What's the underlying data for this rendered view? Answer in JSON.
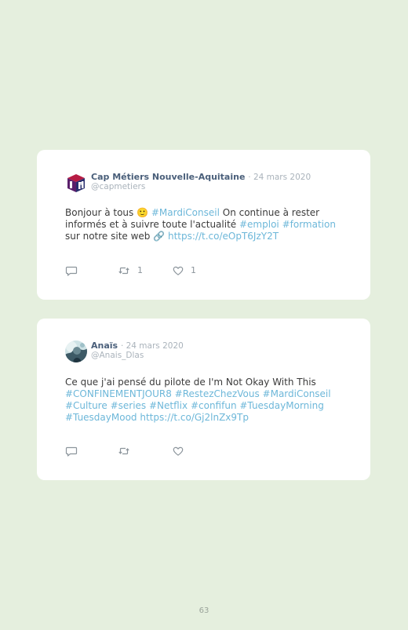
{
  "tweets": [
    {
      "author_name": "Cap Métiers Nouvelle-Aquitaine",
      "date": "· 24 mars 2020",
      "handle": "@capmetiers",
      "avatar_icon": "cap-metiers-logo-icon",
      "text": {
        "t1": "Bonjour à tous 🙂 ",
        "h1": "#MardiConseil",
        "t2": " On continue à rester informés et à suivre toute l'actualité ",
        "h2": "#emploi",
        "t3": " ",
        "h3": "#formation",
        "t4": " sur notre site web 🔗 ",
        "url": "https://t.co/eOpT6JzY2T"
      },
      "retweets": "1",
      "likes": "1"
    },
    {
      "author_name": "Anaïs",
      "date": "· 24 mars 2020",
      "handle": "@Anais_Dlas",
      "avatar_icon": "user-avatar-icon",
      "text": {
        "t1": "Ce que j'ai pensé du pilote de I'm Not Okay With This ",
        "h1": "#CONFINEMENTJOUR8",
        "h2": "#RestezChezVous",
        "h3": "#MardiConseil",
        "h4": "#Culture",
        "h5": "#series",
        "h6": "#Netflix",
        "h7": "#confifun",
        "h8": "#TuesdayMorning",
        "h9": "#TuesdayMood",
        "url": "https://t.co/Gj2lnZx9Tp"
      },
      "retweets": "",
      "likes": ""
    }
  ],
  "page_number": "63",
  "colors": {
    "background": "#e5efde",
    "card": "#ffffff",
    "link": "#6db7d9",
    "author": "#4a5f7a",
    "muted": "#aab3bb",
    "icon": "#8c959c"
  },
  "icons": {
    "reply": "speech-bubble-icon",
    "retweet": "retweet-arrows-icon",
    "like": "heart-outline-icon"
  }
}
